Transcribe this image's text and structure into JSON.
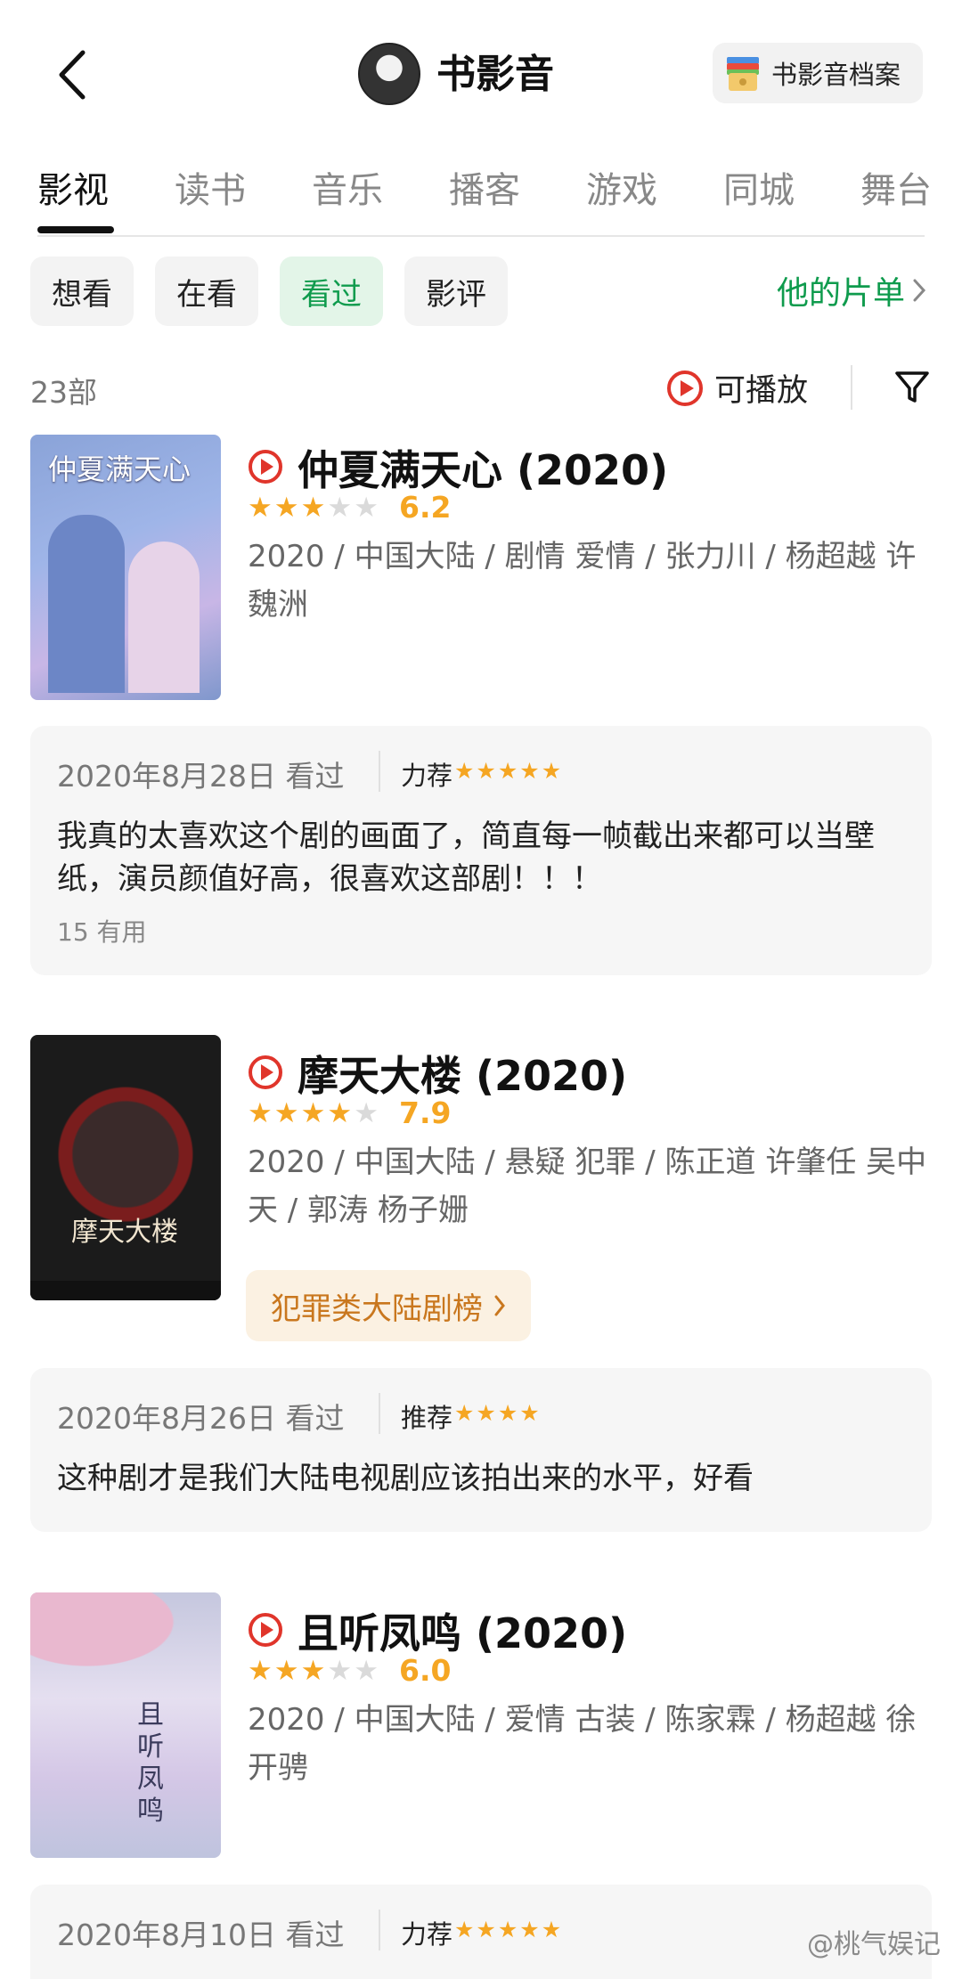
{
  "header": {
    "title": "书影音",
    "archive_label": "书影音档案",
    "back_icon": "chevron-left-icon"
  },
  "tabs": [
    {
      "label": "影视",
      "active": true
    },
    {
      "label": "读书",
      "active": false
    },
    {
      "label": "音乐",
      "active": false
    },
    {
      "label": "播客",
      "active": false
    },
    {
      "label": "游戏",
      "active": false
    },
    {
      "label": "同城",
      "active": false
    },
    {
      "label": "舞台",
      "active": false
    }
  ],
  "filters": [
    {
      "label": "想看",
      "active": false
    },
    {
      "label": "在看",
      "active": false
    },
    {
      "label": "看过",
      "active": true
    },
    {
      "label": "影评",
      "active": false
    }
  ],
  "his_list_label": "他的片单",
  "count_label": "23部",
  "playable_label": "可播放",
  "movies": [
    {
      "title": "仲夏满天心 (2020)",
      "stars": 3,
      "rating": "6.2",
      "meta": "2020 / 中国大陆 / 剧情 爱情 / 张力川 / 杨超越 许魏洲",
      "poster_text": "仲夏满天心",
      "review": {
        "date": "2020年8月28日 看过",
        "label": "力荐",
        "stars": 5,
        "text": "我真的太喜欢这个剧的画面了，简直每一帧截出来都可以当壁纸，演员颜值好高，很喜欢这部剧！！！",
        "useful": "15 有用"
      }
    },
    {
      "title": "摩天大楼 (2020)",
      "stars": 4,
      "rating": "7.9",
      "meta": "2020 / 中国大陆 / 悬疑 犯罪 / 陈正道 许肇任 吴中天 / 郭涛 杨子姗",
      "poster_text": "摩天大楼",
      "rank_badge": "犯罪类大陆剧榜",
      "review": {
        "date": "2020年8月26日 看过",
        "label": "推荐",
        "stars": 4,
        "text": "这种剧才是我们大陆电视剧应该拍出来的水平，好看"
      }
    },
    {
      "title": "且听凤鸣 (2020)",
      "stars": 3,
      "rating": "6.0",
      "meta": "2020 / 中国大陆 / 爱情 古装 / 陈家霖 / 杨超越 徐开骋",
      "poster_text": "且听凤鸣",
      "review": {
        "date": "2020年8月10日 看过",
        "label": "力荐",
        "stars": 5
      }
    }
  ],
  "watermark": "@桃气娱记",
  "colors": {
    "accent_green": "#0f9b4d",
    "star_orange": "#f5a623",
    "play_red": "#e0352b"
  }
}
